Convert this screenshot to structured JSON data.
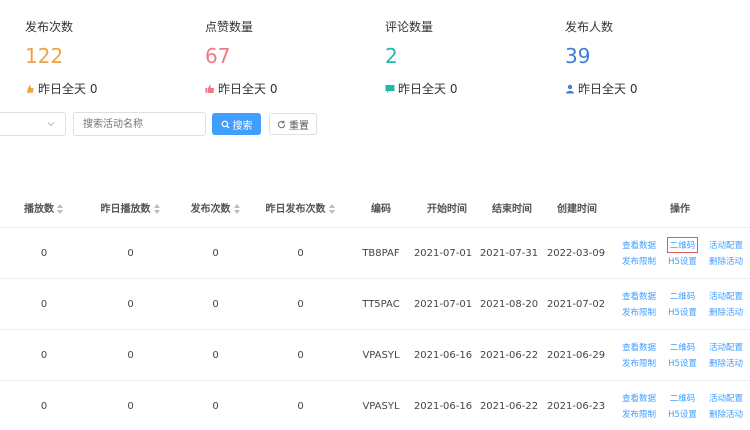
{
  "stats": [
    {
      "label": "发布次数",
      "value": "122",
      "color": "#f0a24a",
      "sub": "昨日全天 0",
      "icon": "thumb-icon"
    },
    {
      "label": "点赞数量",
      "value": "67",
      "color": "#ee7b84",
      "sub": "昨日全天 0",
      "icon": "like-icon"
    },
    {
      "label": "评论数量",
      "value": "2",
      "color": "#23b8a3",
      "sub": "昨日全天 0",
      "icon": "comment-icon"
    },
    {
      "label": "发布人数",
      "value": "39",
      "color": "#3d7fd9",
      "sub": "昨日全天 0",
      "icon": "user-icon"
    }
  ],
  "filter": {
    "search_placeholder": "搜索活动名称",
    "search_button": "搜索",
    "reset_button": "重置"
  },
  "table": {
    "columns": [
      "播放数",
      "昨日播放数",
      "发布次数",
      "昨日发布次数",
      "编码",
      "开始时间",
      "结束时间",
      "创建时间",
      "操作"
    ],
    "rows": [
      {
        "play": "0",
        "yplay": "0",
        "pub": "0",
        "ypub": "0",
        "code": "TB8PAF",
        "start": "2021-07-01",
        "end": "2021-07-31",
        "created": "2022-03-09"
      },
      {
        "play": "0",
        "yplay": "0",
        "pub": "0",
        "ypub": "0",
        "code": "TT5PAC",
        "start": "2021-07-01",
        "end": "2021-08-20",
        "created": "2021-07-02"
      },
      {
        "play": "0",
        "yplay": "0",
        "pub": "0",
        "ypub": "0",
        "code": "VPASYL",
        "start": "2021-06-16",
        "end": "2021-06-22",
        "created": "2021-06-29"
      },
      {
        "play": "0",
        "yplay": "0",
        "pub": "0",
        "ypub": "0",
        "code": "VPASYL",
        "start": "2021-06-16",
        "end": "2021-06-22",
        "created": "2021-06-23"
      }
    ],
    "actions": {
      "view_data": "查看数据",
      "qrcode": "二维码",
      "config": "活动配置",
      "publish_limit": "发布限制",
      "h5_settings": "H5设置",
      "delete": "删除活动"
    }
  },
  "colors": {
    "accent": "#409eff",
    "highlight": "#e05a5a"
  }
}
